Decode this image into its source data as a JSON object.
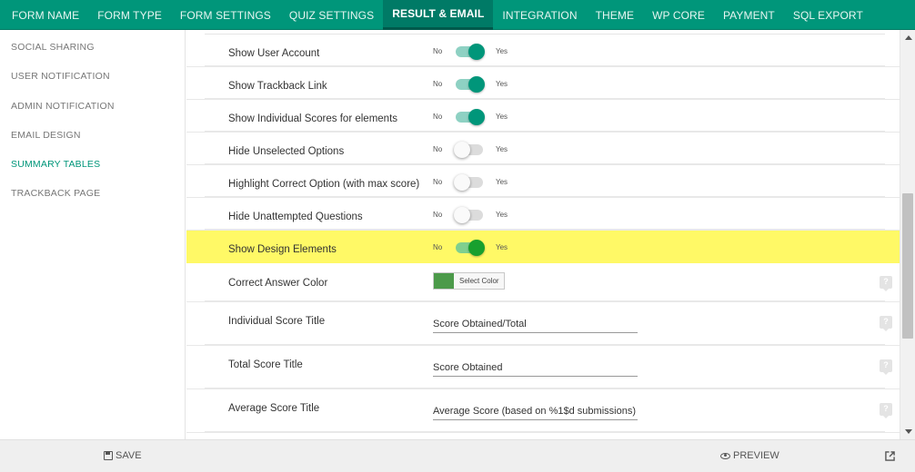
{
  "tabs": [
    {
      "label": "FORM NAME",
      "active": false
    },
    {
      "label": "FORM TYPE",
      "active": false
    },
    {
      "label": "FORM SETTINGS",
      "active": false
    },
    {
      "label": "QUIZ SETTINGS",
      "active": false
    },
    {
      "label": "RESULT & EMAIL",
      "active": true
    },
    {
      "label": "INTEGRATION",
      "active": false
    },
    {
      "label": "THEME",
      "active": false
    },
    {
      "label": "WP CORE",
      "active": false
    },
    {
      "label": "PAYMENT",
      "active": false
    },
    {
      "label": "SQL EXPORT",
      "active": false
    }
  ],
  "sidebar": {
    "items": [
      {
        "label": "SOCIAL SHARING",
        "active": false
      },
      {
        "label": "USER NOTIFICATION",
        "active": false
      },
      {
        "label": "ADMIN NOTIFICATION",
        "active": false
      },
      {
        "label": "EMAIL DESIGN",
        "active": false
      },
      {
        "label": "SUMMARY TABLES",
        "active": true
      },
      {
        "label": "TRACKBACK PAGE",
        "active": false
      }
    ]
  },
  "toggle_text": {
    "no": "No",
    "yes": "Yes"
  },
  "settings": {
    "toggles": [
      {
        "label": "Show User Account",
        "on": true
      },
      {
        "label": "Show Trackback Link",
        "on": true
      },
      {
        "label": "Show Individual Scores for elements",
        "on": true
      },
      {
        "label": "Hide Unselected Options",
        "on": false
      },
      {
        "label": "Highlight Correct Option (with max score)",
        "on": false
      },
      {
        "label": "Hide Unattempted Questions",
        "on": false
      },
      {
        "label": "Show Design Elements",
        "on": true
      }
    ],
    "correct_answer_color": {
      "label": "Correct Answer Color",
      "button_label": "Select Color",
      "color": "#4c9a4a"
    },
    "text_fields": [
      {
        "label": "Individual Score Title",
        "value": "Score Obtained/Total"
      },
      {
        "label": "Total Score Title",
        "value": "Score Obtained"
      },
      {
        "label": "Average Score Title",
        "value": "Average Score (based on %1$d submissions)"
      }
    ]
  },
  "footer": {
    "save_label": "SAVE",
    "preview_label": "PREVIEW"
  },
  "colors": {
    "accent": "#00967a",
    "highlight": "#fff966",
    "toggle_on": "#00967a"
  }
}
